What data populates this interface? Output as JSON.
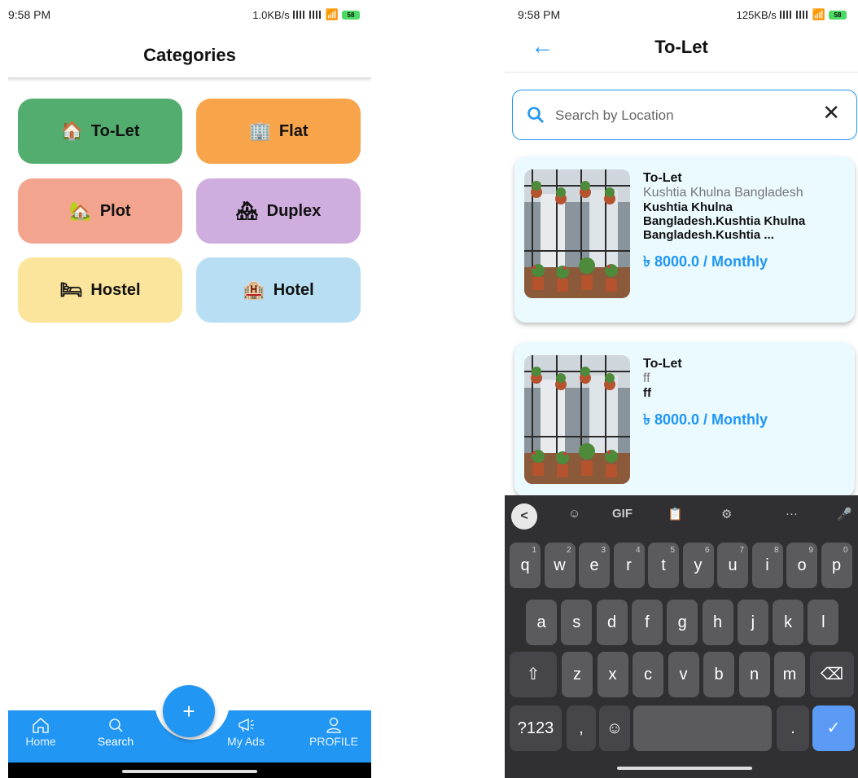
{
  "left": {
    "status": {
      "time": "9:58 PM",
      "net": "1.0KB/s"
    },
    "title": "Categories",
    "categories": [
      {
        "label": "To-Let",
        "icon": "house-hand-icon",
        "glyph": "🏠",
        "color": "#52ad6e"
      },
      {
        "label": "Flat",
        "icon": "building-icon",
        "glyph": "🏢",
        "color": "#f7a44a"
      },
      {
        "label": "Plot",
        "icon": "home-icon",
        "glyph": "🏡",
        "color": "#f3a48f"
      },
      {
        "label": "Duplex",
        "icon": "duplex-icon",
        "glyph": "🏘",
        "color": "#d0addf"
      },
      {
        "label": "Hostel",
        "icon": "bunk-bed-icon",
        "glyph": "🛏",
        "color": "#fbe49b"
      },
      {
        "label": "Hotel",
        "icon": "hotel-icon",
        "glyph": "🏨",
        "color": "#b7def3"
      }
    ],
    "nav": {
      "home": "Home",
      "search": "Search",
      "fab": "+",
      "myads": "My Ads",
      "profile": "PROFILE"
    },
    "accent": "#2196f3"
  },
  "right": {
    "status": {
      "time": "9:58 PM",
      "net": "125KB/s"
    },
    "title": "To-Let",
    "search": {
      "placeholder": "Search by Location",
      "value": ""
    },
    "listings": [
      {
        "title": "To-Let",
        "location": "Kushtia Khulna Bangladesh",
        "description": "Kushtia Khulna Bangladesh.Kushtia Khulna Bangladesh.Kushtia ...",
        "price": "৳ 8000.0 / Monthly"
      },
      {
        "title": "To-Let",
        "location": "ff",
        "description": "ff",
        "price": "৳ 8000.0 / Monthly"
      }
    ],
    "keyboard": {
      "toolbar": [
        "GIF"
      ],
      "row1": [
        [
          "q",
          "1"
        ],
        [
          "w",
          "2"
        ],
        [
          "e",
          "3"
        ],
        [
          "r",
          "4"
        ],
        [
          "t",
          "5"
        ],
        [
          "y",
          "6"
        ],
        [
          "u",
          "7"
        ],
        [
          "i",
          "8"
        ],
        [
          "o",
          "9"
        ],
        [
          "p",
          "0"
        ]
      ],
      "row2": [
        "a",
        "s",
        "d",
        "f",
        "g",
        "h",
        "j",
        "k",
        "l"
      ],
      "row3": [
        "z",
        "x",
        "c",
        "v",
        "b",
        "n",
        "m"
      ],
      "symbols": "?123",
      "comma": ",",
      "period": "."
    }
  }
}
